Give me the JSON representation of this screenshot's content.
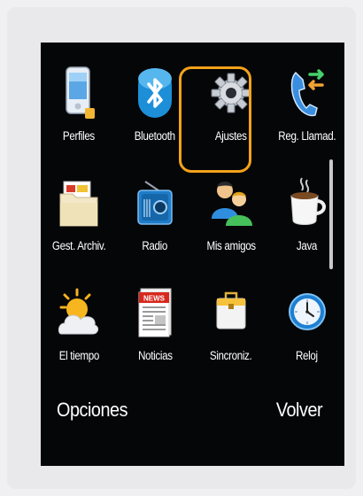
{
  "menu": {
    "items": [
      {
        "label": "Perfiles",
        "icon": "phone-profile-icon"
      },
      {
        "label": "Bluetooth",
        "icon": "bluetooth-icon"
      },
      {
        "label": "Ajustes",
        "icon": "gear-icon",
        "selected": true
      },
      {
        "label": "Reg. Llamad.",
        "icon": "call-log-icon"
      },
      {
        "label": "Gest. Archiv.",
        "icon": "folder-icon"
      },
      {
        "label": "Radio",
        "icon": "radio-icon"
      },
      {
        "label": "Mis amigos",
        "icon": "friends-icon"
      },
      {
        "label": "Java",
        "icon": "coffee-cup-icon"
      },
      {
        "label": "El tiempo",
        "icon": "weather-icon"
      },
      {
        "label": "Noticias",
        "icon": "news-icon"
      },
      {
        "label": "Sincroniz.",
        "icon": "sync-briefcase-icon"
      },
      {
        "label": "Reloj",
        "icon": "clock-icon"
      }
    ]
  },
  "softkeys": {
    "left": "Opciones",
    "right": "Volver"
  },
  "colors": {
    "selection": "#f4a21b",
    "screen_background": "#050608"
  }
}
